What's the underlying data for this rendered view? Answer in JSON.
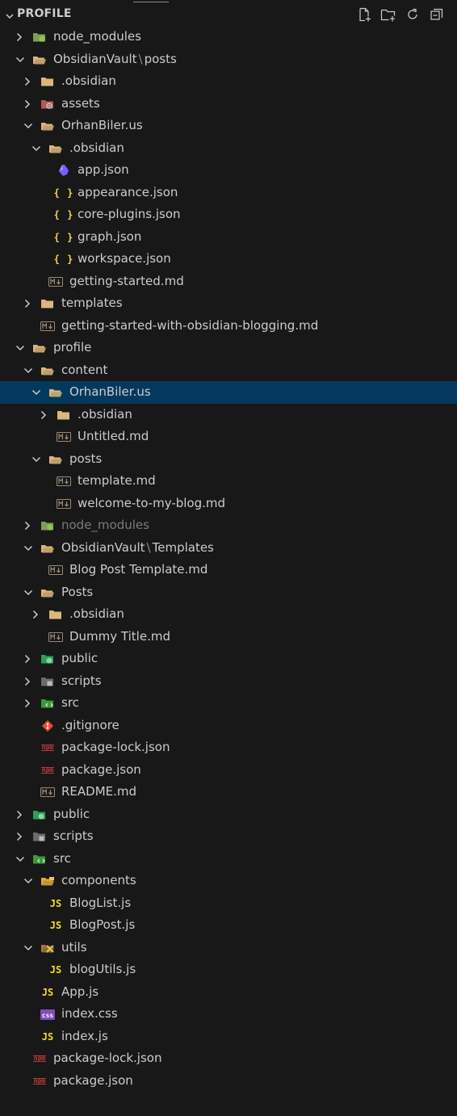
{
  "explorer": {
    "title": "PROFILE",
    "actions": [
      {
        "name": "new-file-icon"
      },
      {
        "name": "new-folder-icon"
      },
      {
        "name": "refresh-icon"
      },
      {
        "name": "collapse-all-icon"
      }
    ]
  },
  "tree": [
    {
      "label": "node_modules",
      "depth": 0,
      "kind": "folder",
      "open": false,
      "icon": "node-folder-icon"
    },
    {
      "label": "ObsidianVault",
      "label2": "posts",
      "depth": 0,
      "kind": "folder",
      "open": true,
      "icon": "folder-open-icon"
    },
    {
      "label": ".obsidian",
      "depth": 1,
      "kind": "folder",
      "open": false,
      "icon": "folder-icon"
    },
    {
      "label": "assets",
      "depth": 1,
      "kind": "folder",
      "open": false,
      "icon": "assets-folder-icon"
    },
    {
      "label": "OrhanBiler.us",
      "depth": 1,
      "kind": "folder",
      "open": true,
      "icon": "folder-open-icon"
    },
    {
      "label": ".obsidian",
      "depth": 2,
      "kind": "folder",
      "open": true,
      "icon": "folder-open-icon"
    },
    {
      "label": "app.json",
      "depth": 3,
      "kind": "file",
      "icon": "obsidian-icon"
    },
    {
      "label": "appearance.json",
      "depth": 3,
      "kind": "file",
      "icon": "json-icon"
    },
    {
      "label": "core-plugins.json",
      "depth": 3,
      "kind": "file",
      "icon": "json-icon"
    },
    {
      "label": "graph.json",
      "depth": 3,
      "kind": "file",
      "icon": "json-icon"
    },
    {
      "label": "workspace.json",
      "depth": 3,
      "kind": "file",
      "icon": "json-icon"
    },
    {
      "label": "getting-started.md",
      "depth": 2,
      "kind": "file",
      "icon": "markdown-icon"
    },
    {
      "label": "templates",
      "depth": 1,
      "kind": "folder",
      "open": false,
      "icon": "folder-icon"
    },
    {
      "label": "getting-started-with-obsidian-blogging.md",
      "depth": 1,
      "kind": "file",
      "icon": "markdown-icon"
    },
    {
      "label": "profile",
      "depth": 0,
      "kind": "folder",
      "open": true,
      "icon": "folder-open-icon"
    },
    {
      "label": "content",
      "depth": 1,
      "kind": "folder",
      "open": true,
      "icon": "folder-open-icon"
    },
    {
      "label": "OrhanBiler.us",
      "depth": 2,
      "kind": "folder",
      "open": true,
      "icon": "folder-open-icon",
      "selected": true
    },
    {
      "label": ".obsidian",
      "depth": 3,
      "kind": "folder",
      "open": false,
      "icon": "folder-icon"
    },
    {
      "label": "Untitled.md",
      "depth": 3,
      "kind": "file",
      "icon": "markdown-icon"
    },
    {
      "label": "posts",
      "depth": 2,
      "kind": "folder",
      "open": true,
      "icon": "folder-open-icon"
    },
    {
      "label": "template.md",
      "depth": 3,
      "kind": "file",
      "icon": "markdown-icon"
    },
    {
      "label": "welcome-to-my-blog.md",
      "depth": 3,
      "kind": "file",
      "icon": "markdown-icon"
    },
    {
      "label": "node_modules",
      "depth": 1,
      "kind": "folder",
      "open": false,
      "icon": "node-folder-icon",
      "dim": true
    },
    {
      "label": "ObsidianVault",
      "label2": "Templates",
      "depth": 1,
      "kind": "folder",
      "open": true,
      "icon": "folder-open-icon"
    },
    {
      "label": "Blog Post Template.md",
      "depth": 2,
      "kind": "file",
      "icon": "markdown-icon"
    },
    {
      "label": "Posts",
      "depth": 1,
      "kind": "folder",
      "open": true,
      "icon": "folder-open-icon"
    },
    {
      "label": ".obsidian",
      "depth": 2,
      "kind": "folder",
      "open": false,
      "icon": "folder-icon"
    },
    {
      "label": "Dummy Title.md",
      "depth": 2,
      "kind": "file",
      "icon": "markdown-icon"
    },
    {
      "label": "public",
      "depth": 1,
      "kind": "folder",
      "open": false,
      "icon": "public-folder-icon"
    },
    {
      "label": "scripts",
      "depth": 1,
      "kind": "folder",
      "open": false,
      "icon": "scripts-folder-icon"
    },
    {
      "label": "src",
      "depth": 1,
      "kind": "folder",
      "open": false,
      "icon": "src-folder-icon"
    },
    {
      "label": ".gitignore",
      "depth": 1,
      "kind": "file",
      "icon": "git-icon"
    },
    {
      "label": "package-lock.json",
      "depth": 1,
      "kind": "file",
      "icon": "npm-icon"
    },
    {
      "label": "package.json",
      "depth": 1,
      "kind": "file",
      "icon": "npm-icon"
    },
    {
      "label": "README.md",
      "depth": 1,
      "kind": "file",
      "icon": "markdown-icon"
    },
    {
      "label": "public",
      "depth": 0,
      "kind": "folder",
      "open": false,
      "icon": "public-folder-icon"
    },
    {
      "label": "scripts",
      "depth": 0,
      "kind": "folder",
      "open": false,
      "icon": "scripts-folder-icon"
    },
    {
      "label": "src",
      "depth": 0,
      "kind": "folder",
      "open": true,
      "icon": "src-folder-icon"
    },
    {
      "label": "components",
      "depth": 1,
      "kind": "folder",
      "open": true,
      "icon": "components-folder-icon"
    },
    {
      "label": "BlogList.js",
      "depth": 2,
      "kind": "file",
      "icon": "js-icon"
    },
    {
      "label": "BlogPost.js",
      "depth": 2,
      "kind": "file",
      "icon": "js-icon"
    },
    {
      "label": "utils",
      "depth": 1,
      "kind": "folder",
      "open": true,
      "icon": "utils-folder-icon"
    },
    {
      "label": "blogUtils.js",
      "depth": 2,
      "kind": "file",
      "icon": "js-icon"
    },
    {
      "label": "App.js",
      "depth": 1,
      "kind": "file",
      "icon": "js-icon"
    },
    {
      "label": "index.css",
      "depth": 1,
      "kind": "file",
      "icon": "css-icon"
    },
    {
      "label": "index.js",
      "depth": 1,
      "kind": "file",
      "icon": "js-icon"
    },
    {
      "label": "package-lock.json",
      "depth": 0,
      "kind": "file",
      "icon": "npm-icon"
    },
    {
      "label": "package.json",
      "depth": 0,
      "kind": "file",
      "icon": "npm-icon"
    }
  ],
  "icon_text": {
    "js": "JS",
    "css": "css",
    "json": "{ }",
    "npm": "npm"
  },
  "colors": {
    "background": "#181818",
    "selected": "#04395e",
    "folder": "#dcb67a",
    "json": "#f1d35f",
    "js": "#f5de19",
    "css": "#7e4fb8",
    "npm": "#c23a3a",
    "git": "#e44c30",
    "node": "#8cc84b",
    "markdown": "#9a8a78"
  }
}
